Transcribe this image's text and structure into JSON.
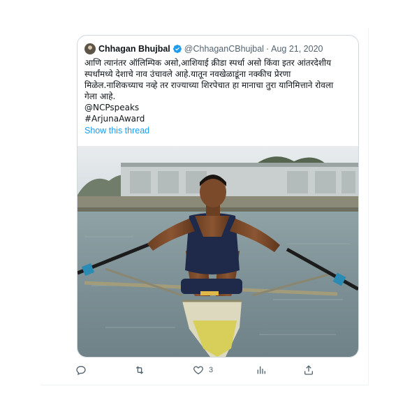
{
  "tweet": {
    "author_name": "Chhagan Bhujbal",
    "author_handle": "@ChhaganCBhujbal",
    "separator": "·",
    "date": "Aug 21, 2020",
    "text_lines": [
      "आणि त्यानंतर ऑलिम्पिक असो,आशियाई क्रीडा स्पर्धा असो किंवा इतर आंतरदेशीय",
      "स्पर्धांमध्ये देशाचे नाव उंचावले आहे.यातून नवखेळाडूंना नक्कीच प्रेरणा",
      "मिळेल.नाशिकच्याच नव्हे तर राज्याच्या शिरपेचात हा मानाचा तुरा यानिमित्ताने रोवला",
      "गेला आहे."
    ],
    "mention": "@NCPspeaks",
    "hashtag": "#ArjunaAward",
    "show_thread": "Show this thread"
  },
  "actions": {
    "like_count": "3"
  },
  "icons": {
    "avatar": "profile-avatar",
    "verified": "verified-badge-icon",
    "reply": "reply-icon",
    "retweet": "retweet-icon",
    "like": "heart-icon",
    "views": "views-bar-chart-icon",
    "share": "share-icon"
  },
  "colors": {
    "link": "#1d9bf0",
    "verified": "#1d9bf0",
    "text": "#0f1419",
    "muted": "#536471",
    "border": "#cfd9de"
  }
}
